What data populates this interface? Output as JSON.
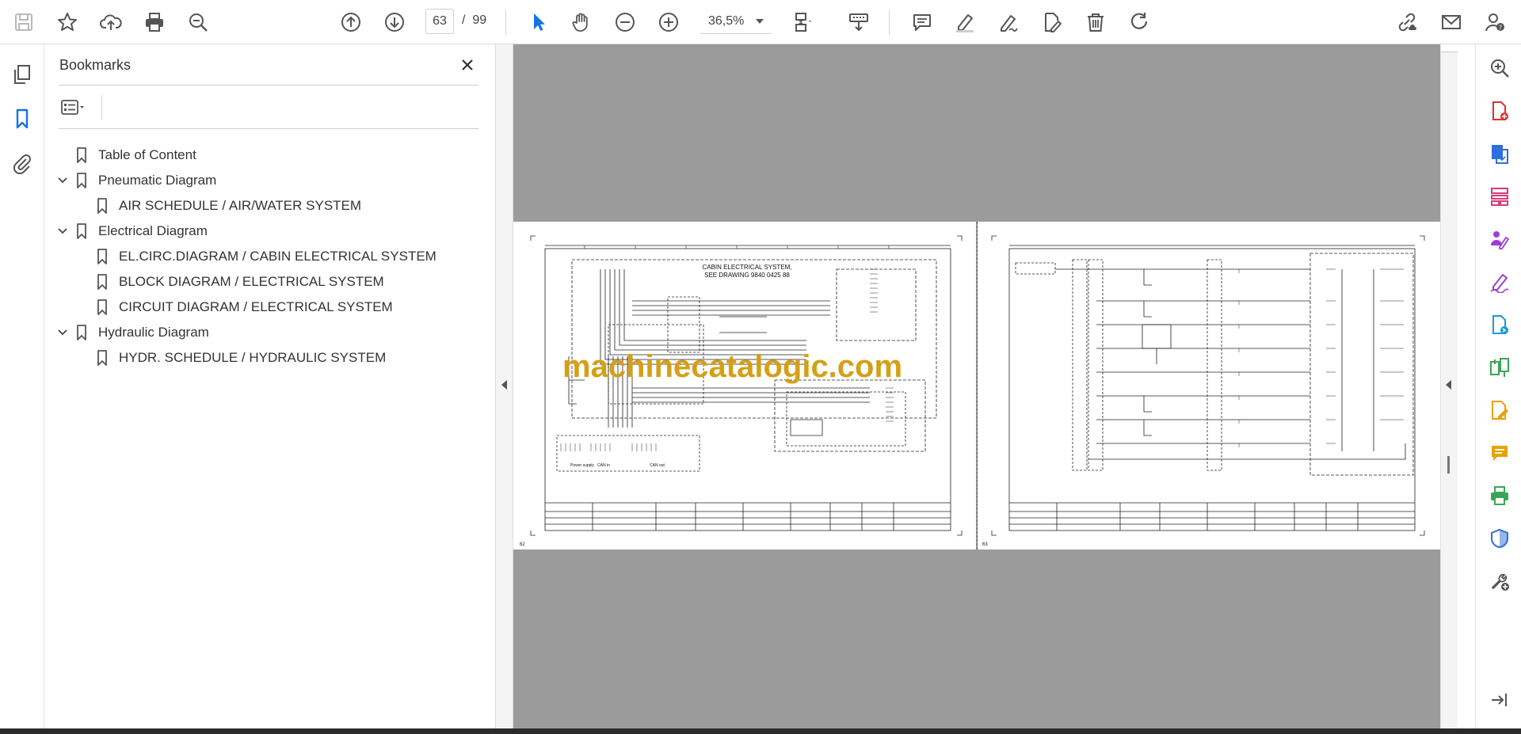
{
  "toolbar": {
    "page_current": "63",
    "page_separator": "/",
    "page_total": "99",
    "zoom": "36,5%"
  },
  "bookmarks": {
    "title": "Bookmarks",
    "items": [
      {
        "label": "Table of Content",
        "level": 0,
        "expandable": false
      },
      {
        "label": "Pneumatic Diagram",
        "level": 0,
        "expandable": true
      },
      {
        "label": "AIR SCHEDULE / AIR/WATER SYSTEM",
        "level": 1,
        "expandable": false
      },
      {
        "label": "Electrical Diagram",
        "level": 0,
        "expandable": true
      },
      {
        "label": "EL.CIRC.DIAGRAM / CABIN ELECTRICAL SYSTEM",
        "level": 1,
        "expandable": false
      },
      {
        "label": "BLOCK DIAGRAM / ELECTRICAL SYSTEM",
        "level": 1,
        "expandable": false
      },
      {
        "label": "CIRCUIT DIAGRAM / ELECTRICAL SYSTEM",
        "level": 1,
        "expandable": false
      },
      {
        "label": "Hydraulic Diagram",
        "level": 0,
        "expandable": true
      },
      {
        "label": "HYDR. SCHEDULE / HYDRAULIC SYSTEM",
        "level": 1,
        "expandable": false
      }
    ]
  },
  "document": {
    "watermark": "machinecatalogic.com",
    "left_page": {
      "header_line1": "CABIN ELECTRICAL SYSTEM,",
      "header_line2": "SEE DRAWING 9840 0425 88",
      "page_no": "62",
      "labels": [
        "Power supply",
        "CAN in",
        "CAN out"
      ]
    },
    "right_page": {
      "page_no": "63"
    }
  },
  "colors": {
    "accent_blue": "#1473e6",
    "watermark": "#d4a017",
    "doc_background": "#9b9b9b"
  }
}
